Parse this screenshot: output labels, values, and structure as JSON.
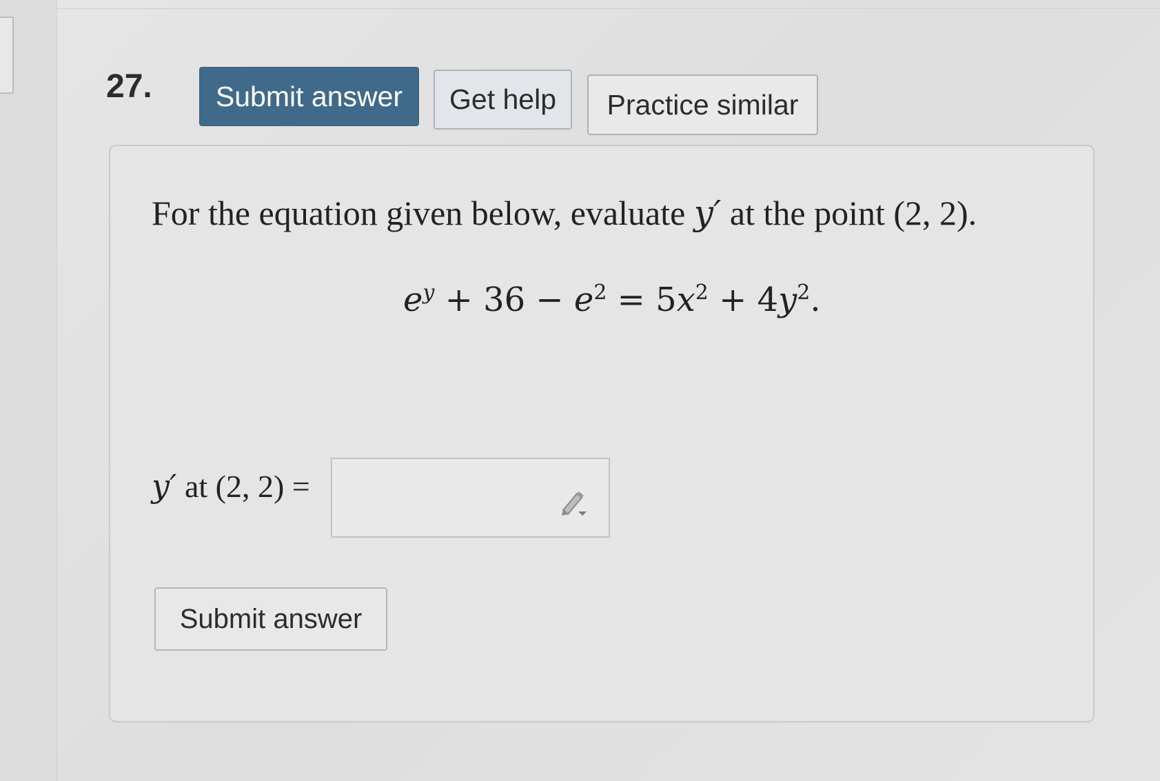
{
  "question": {
    "number": "27.",
    "toolbar": {
      "submit_label": "Submit answer",
      "help_label": "Get help",
      "practice_label": "Practice similar"
    },
    "prompt": {
      "lead": "For the equation given below, evaluate ",
      "var": "y′",
      "tail": " at the point (2, 2)."
    },
    "equation": {
      "t1_base": "e",
      "t1_exp": "y",
      "t2": " + 36 − ",
      "t3_base": "e",
      "t3_exp": "2",
      "t4": " = 5",
      "t5_base": "x",
      "t5_exp": "2",
      "t6": " + 4",
      "t7_base": "y",
      "t7_exp": "2",
      "t8": "."
    },
    "answer": {
      "label_var": "y′",
      "label_rest": " at (2, 2) =",
      "value": "",
      "placeholder": ""
    },
    "submit_bottom_label": "Submit answer"
  },
  "icons": {
    "answer_tool": "pencil-icon"
  },
  "colors": {
    "primary_button": "#3f6a8a",
    "help_button": "#e2e6ea"
  }
}
